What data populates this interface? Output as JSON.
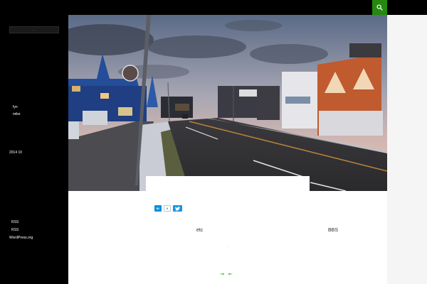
{
  "header": {
    "search_icon": "search-icon",
    "accent_color": "#24890d"
  },
  "sidebar": {
    "search_placeholder": "...",
    "links": [
      "fyn",
      "mike"
    ],
    "archive": "2014  10",
    "meta": {
      "rss1": "RSS",
      "rss2": "RSS",
      "wordpress": "WordPress.org"
    }
  },
  "post": {
    "share": {
      "hatena_label": "B!",
      "hatena_count": "0",
      "tweet_icon": "twitter-bird-icon"
    },
    "categories": [
      "etc",
      "BBS"
    ],
    "separator": ".",
    "nav": {
      "prev": "⇥",
      "next": "⇤"
    }
  }
}
